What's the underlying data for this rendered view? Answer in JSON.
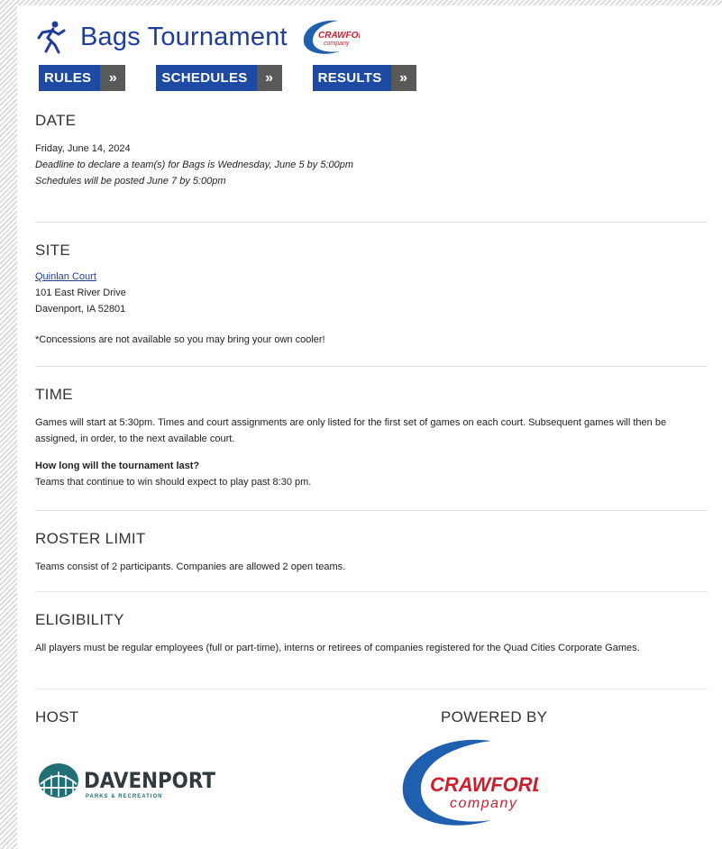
{
  "header": {
    "title": "Bags Tournament",
    "icon": "runner-icon",
    "logo_text_top": "CRAWFORD",
    "logo_text_bottom": "company"
  },
  "nav": [
    {
      "label": "RULES",
      "arrow": "»"
    },
    {
      "label": "SCHEDULES",
      "arrow": "»"
    },
    {
      "label": "RESULTS",
      "arrow": "»"
    }
  ],
  "date": {
    "heading": "DATE",
    "line1": "Friday, June 14, 2024",
    "line2": "Deadline to declare a team(s) for Bags is Wednesday, June 5 by 5:00pm",
    "line3": "Schedules will be posted June 7 by 5:00pm"
  },
  "site": {
    "heading": "SITE",
    "venue_link": "Quinlan Court",
    "address1": "101 East River Drive",
    "address2": "Davenport, IA 52801",
    "note": "*Concessions are not available so you may bring your own cooler!"
  },
  "time": {
    "heading": "TIME",
    "body": "Games will start at 5:30pm. Times and court assignments are only listed for the first set of games on each court. Subsequent games will then be assigned, in order, to the next available court.",
    "question": "How long will the tournament last?",
    "answer": "Teams that continue to win should expect to play past 8:30 pm."
  },
  "roster": {
    "heading": "ROSTER LIMIT",
    "body": "Teams consist of 2 participants. Companies are allowed 2 open teams."
  },
  "eligibility": {
    "heading": "ELIGIBILITY",
    "body": "All players must be regular employees (full or part-time), interns or retirees of companies registered for the Quad Cities Corporate Games."
  },
  "footer": {
    "host_heading": "HOST",
    "powered_heading": "POWERED BY",
    "host_logo_text": "DAVENPORT",
    "host_logo_sub": "PARKS & RECREATION",
    "powered_logo_top": "CRAWFORD",
    "powered_logo_bottom": "company"
  },
  "colors": {
    "title_blue": "#1f3d99",
    "nav_blue": "#1d4aa3",
    "nav_arrow_gray": "#595959",
    "crawford_red": "#cc1f2e",
    "crawford_blue": "#1f5fb0"
  }
}
